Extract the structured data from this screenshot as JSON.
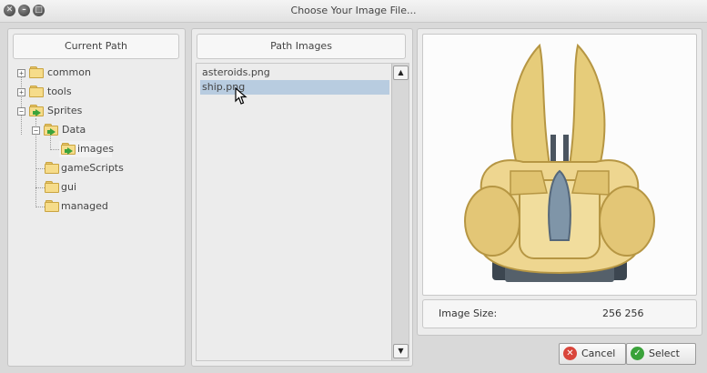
{
  "window": {
    "title": "Choose Your Image File...",
    "controls": [
      "close",
      "minimize",
      "maximize"
    ]
  },
  "current_path": {
    "header": "Current Path",
    "tree": [
      {
        "label": "common",
        "expanded": false,
        "selected": false
      },
      {
        "label": "tools",
        "expanded": false,
        "selected": false
      },
      {
        "label": "Sprites",
        "expanded": true,
        "selected": false
      },
      {
        "label": "Data",
        "expanded": true,
        "selected": false
      },
      {
        "label": "images",
        "expanded": false,
        "selected": true
      },
      {
        "label": "gameScripts",
        "expanded": false,
        "selected": false
      },
      {
        "label": "gui",
        "expanded": false,
        "selected": false
      },
      {
        "label": "managed",
        "expanded": false,
        "selected": false
      }
    ]
  },
  "path_images": {
    "header": "Path Images",
    "files": [
      {
        "name": "asteroids.png",
        "selected": false
      },
      {
        "name": "ship.png",
        "selected": true
      }
    ]
  },
  "preview": {
    "image_size_label": "Image Size:",
    "image_size_value": "256 256"
  },
  "buttons": {
    "cancel": "Cancel",
    "select": "Select"
  },
  "colors": {
    "selection": "#b8cce0",
    "folder": "#f6dc8a",
    "cancel_icon": "#d9453b",
    "select_icon": "#3aa23a"
  }
}
